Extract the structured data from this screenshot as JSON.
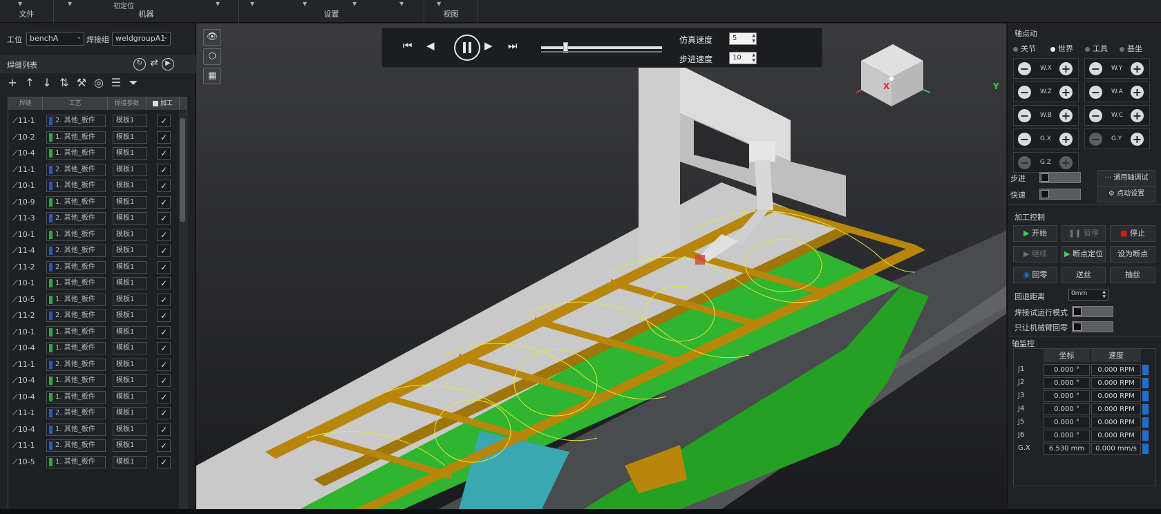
{
  "ribbon": {
    "groups": [
      {
        "label": "文件",
        "top": ""
      },
      {
        "label": "机器",
        "top": "初定位"
      },
      {
        "label": "设置",
        "top": ""
      },
      {
        "label": "视图",
        "top": ""
      }
    ]
  },
  "left": {
    "station_label": "工位",
    "station_value": "benchA",
    "group_label": "焊接组",
    "group_value": "weldgroupA1",
    "seam_list_title": "焊缝列表",
    "columns": [
      "焊缝",
      "工艺",
      "焊接参数",
      "加工"
    ],
    "rows": [
      {
        "id": "11-1",
        "proc": "2. 其他_板件",
        "param": "模板1",
        "color": "#2a58b8"
      },
      {
        "id": "10-2",
        "proc": "1. 其他_板件",
        "param": "模板1",
        "color": "#2fa84a"
      },
      {
        "id": "10-4",
        "proc": "1. 其他_板件",
        "param": "模板1",
        "color": "#2fa84a"
      },
      {
        "id": "11-1",
        "proc": "2. 其他_板件",
        "param": "模板1",
        "color": "#2a58b8"
      },
      {
        "id": "10-1",
        "proc": "1. 其他_板件",
        "param": "模板1",
        "color": "#2a58b8"
      },
      {
        "id": "10-9",
        "proc": "1. 其他_板件",
        "param": "模板1",
        "color": "#2fa84a"
      },
      {
        "id": "11-3",
        "proc": "2. 其他_板件",
        "param": "模板1",
        "color": "#2a58b8"
      },
      {
        "id": "10-1",
        "proc": "1. 其他_板件",
        "param": "模板1",
        "color": "#2fa84a"
      },
      {
        "id": "11-4",
        "proc": "2. 其他_板件",
        "param": "模板1",
        "color": "#2a58b8"
      },
      {
        "id": "11-2",
        "proc": "2. 其他_板件",
        "param": "模板1",
        "color": "#2a58b8"
      },
      {
        "id": "10-1",
        "proc": "1. 其他_板件",
        "param": "模板1",
        "color": "#2fa84a"
      },
      {
        "id": "10-5",
        "proc": "1. 其他_板件",
        "param": "模板1",
        "color": "#2fa84a"
      },
      {
        "id": "11-2",
        "proc": "2. 其他_板件",
        "param": "模板1",
        "color": "#2a58b8"
      },
      {
        "id": "10-1",
        "proc": "1. 其他_板件",
        "param": "模板1",
        "color": "#2fa84a"
      },
      {
        "id": "10-4",
        "proc": "1. 其他_板件",
        "param": "模板1",
        "color": "#2fa84a"
      },
      {
        "id": "11-1",
        "proc": "2. 其他_板件",
        "param": "模板1",
        "color": "#2a58b8"
      },
      {
        "id": "10-4",
        "proc": "1. 其他_板件",
        "param": "模板1",
        "color": "#2fa84a"
      },
      {
        "id": "10-4",
        "proc": "1. 其他_板件",
        "param": "模板1",
        "color": "#2fa84a"
      },
      {
        "id": "11-1",
        "proc": "2. 其他_板件",
        "param": "模板1",
        "color": "#2a58b8"
      },
      {
        "id": "10-4",
        "proc": "1. 其他_板件",
        "param": "模板1",
        "color": "#2a58b8"
      },
      {
        "id": "11-1",
        "proc": "2. 其他_板件",
        "param": "模板1",
        "color": "#2a58b8"
      },
      {
        "id": "10-5",
        "proc": "1. 其他_板件",
        "param": "模板1",
        "color": "#2fa84a"
      }
    ],
    "check_mark": "✓"
  },
  "player": {
    "sim_speed_label": "仿真速度",
    "sim_speed_value": "5",
    "step_speed_label": "步进速度",
    "step_speed_value": "10",
    "progress": 0.18
  },
  "cube": {
    "x_label": "X",
    "y_label": "Y"
  },
  "right": {
    "jog_title": "轴点动",
    "frames": [
      "关节",
      "世界",
      "工具",
      "基坐"
    ],
    "axes": [
      "W.X",
      "W.Y",
      "W.Z",
      "W.A",
      "W.B",
      "W.C",
      "G.X",
      "G.Y",
      "G.Z"
    ],
    "step_label": "步进",
    "fast_label": "快速",
    "universal_btn": "通用轴调试",
    "jog_settings_btn": "点动设置",
    "process_title": "加工控制",
    "start_btn": "开始",
    "pause_btn": "暂停",
    "stop_btn": "停止",
    "resume_btn": "继续",
    "bp_locate_btn": "断点定位",
    "set_bp_btn": "设为断点",
    "home_btn": "回零",
    "feed_btn": "送丝",
    "retract_btn": "抽丝",
    "retreat_dist_label": "回退距离",
    "retreat_dist_value": "0mm",
    "weld_test_label": "焊接试运行模式",
    "robot_only_label": "只让机械臂回零",
    "monitor_title": "轴监控",
    "mon_cols": [
      "坐标",
      "速度"
    ],
    "monitor": [
      {
        "name": "J1",
        "pos": "0.000 °",
        "speed": "0.000 RPM"
      },
      {
        "name": "J2",
        "pos": "0.000 °",
        "speed": "0.000 RPM"
      },
      {
        "name": "J3",
        "pos": "0.000 °",
        "speed": "0.000 RPM"
      },
      {
        "name": "J4",
        "pos": "0.000 °",
        "speed": "0.000 RPM"
      },
      {
        "name": "J5",
        "pos": "0.000 °",
        "speed": "0.000 RPM"
      },
      {
        "name": "J6",
        "pos": "0.000 °",
        "speed": "0.000 RPM"
      },
      {
        "name": "G.X",
        "pos": "6.530 mm",
        "speed": "0.000 mm/s"
      }
    ]
  },
  "colors": {
    "accent": "#1e6fd0",
    "beam": "#b8860b",
    "table_green": "#2fb52f",
    "stop_red": "#d41c1c",
    "start_green": "#3ed15a"
  }
}
